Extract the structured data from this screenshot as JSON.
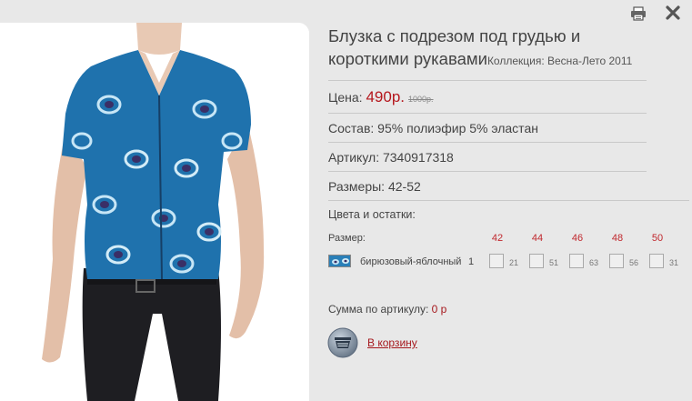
{
  "header": {
    "print_icon": "printer-icon",
    "close_icon": "close-icon"
  },
  "product": {
    "image_icon": "peacock-blouse-photo",
    "title": "Блузка с подрезом под грудью и короткими рукавами",
    "collection": "Коллекция: Весна-Лето 2011",
    "price_label": "Цена:",
    "price": "490р.",
    "old_price": "1000р.",
    "composition": "Состав: 95% полиэфир 5% эластан",
    "article": "Артикул: 7340917318",
    "sizes": "Размеры: 42-52"
  },
  "stock": {
    "heading": "Цвета и остатки:",
    "size_label": "Размер:",
    "size_columns": [
      "42",
      "44",
      "46",
      "48",
      "50"
    ],
    "rows": [
      {
        "color_name": "бирюзовый-яблочный",
        "count": "1",
        "stocks": [
          "21",
          "51",
          "63",
          "56",
          "31"
        ]
      }
    ]
  },
  "summary": {
    "label": "Сумма по артикулу:",
    "value": "0 р"
  },
  "cart": {
    "icon": "basket-icon",
    "label": "В корзину"
  },
  "colors": {
    "accent_red": "#b5171d",
    "background": "#e8e8e8",
    "blouse_blue": "#2a7fb8"
  }
}
